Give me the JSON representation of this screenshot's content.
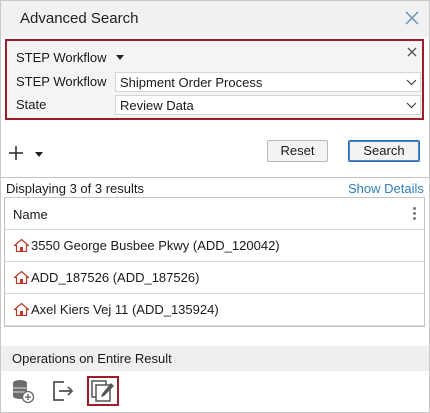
{
  "dialog": {
    "title": "Advanced Search"
  },
  "criteria": {
    "header_label": "STEP Workflow",
    "rows": [
      {
        "label": "STEP Workflow",
        "value": "Shipment Order Process"
      },
      {
        "label": "State",
        "value": "Review Data"
      }
    ]
  },
  "actions": {
    "reset_label": "Reset",
    "search_label": "Search"
  },
  "results": {
    "count_text": "Displaying 3 of 3 results",
    "show_details_label": "Show Details",
    "column_header": "Name",
    "rows": [
      {
        "name": "3550 George Busbee Pkwy",
        "id": "(ADD_120042)"
      },
      {
        "name": "ADD_187526",
        "id": "(ADD_187526)"
      },
      {
        "name": "Axel Kiers Vej 11",
        "id": "(ADD_135924)"
      }
    ]
  },
  "operations": {
    "label": "Operations on Entire Result",
    "icons": [
      "database-add-icon",
      "export-icon",
      "bulk-edit-icon"
    ]
  },
  "colors": {
    "highlight_border": "#9c1c2b",
    "link": "#2f7fc1",
    "house_icon": "#c0392b"
  }
}
